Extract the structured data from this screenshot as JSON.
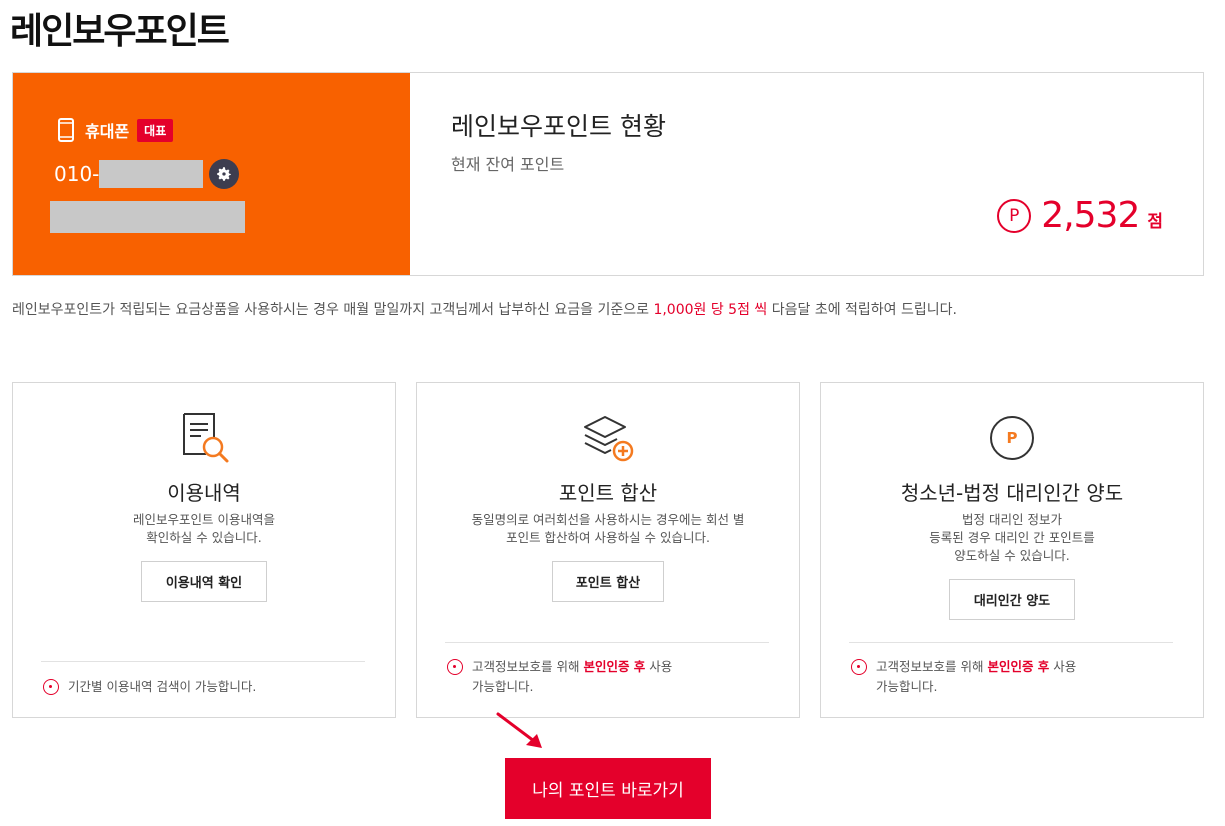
{
  "page": {
    "title": "레인보우포인트"
  },
  "summary": {
    "phone_label": "휴대폰",
    "rep_badge": "대표",
    "phone_prefix": "010-",
    "status_title": "레인보우포인트 현황",
    "status_sub": "현재 잔여 포인트",
    "points_symbol": "P",
    "points_value": "2,532",
    "points_unit": "점"
  },
  "notice": {
    "before": "레인보우포인트가 적립되는 요금상품을 사용하시는 경우 매월 말일까지 고객님께서 납부하신 요금을 기준으로 ",
    "highlight": "1,000원 당 5점 씩",
    "after": " 다음달 초에 적립하여 드립니다."
  },
  "cards": [
    {
      "icon": "document-search-icon",
      "title": "이용내역",
      "desc": [
        "레인보우포인트 이용내역을",
        "확인하실 수 있습니다."
      ],
      "button": "이용내역 확인",
      "note_line1": "기간별 이용내역 검색이 가능합니다."
    },
    {
      "icon": "layers-plus-icon",
      "title": "포인트 합산",
      "desc": [
        "동일명의로 여러회선을 사용하시는 경우에는 회선 별",
        "포인트 합산하여 사용하실 수 있습니다."
      ],
      "button": "포인트 합산",
      "note_before": "고객정보보호를 위해 ",
      "note_highlight": "본인인증 후",
      "note_after": " 사용",
      "note_line2": "가능합니다."
    },
    {
      "icon": "point-circle-icon",
      "icon_letter": "P",
      "title": "청소년-법정 대리인간 양도",
      "desc": [
        "법정 대리인 정보가",
        "등록된 경우 대리인 간 포인트를",
        "양도하실 수 있습니다."
      ],
      "button": "대리인간 양도",
      "note_before": "고객정보보호를 위해 ",
      "note_highlight": "본인인증 후",
      "note_after": " 사용",
      "note_line2": "가능합니다."
    }
  ],
  "cta": {
    "label": "나의 포인트 바로가기"
  },
  "colors": {
    "accent": "#e4002b",
    "orange": "#f86100",
    "icon_orange": "#f47a20"
  }
}
